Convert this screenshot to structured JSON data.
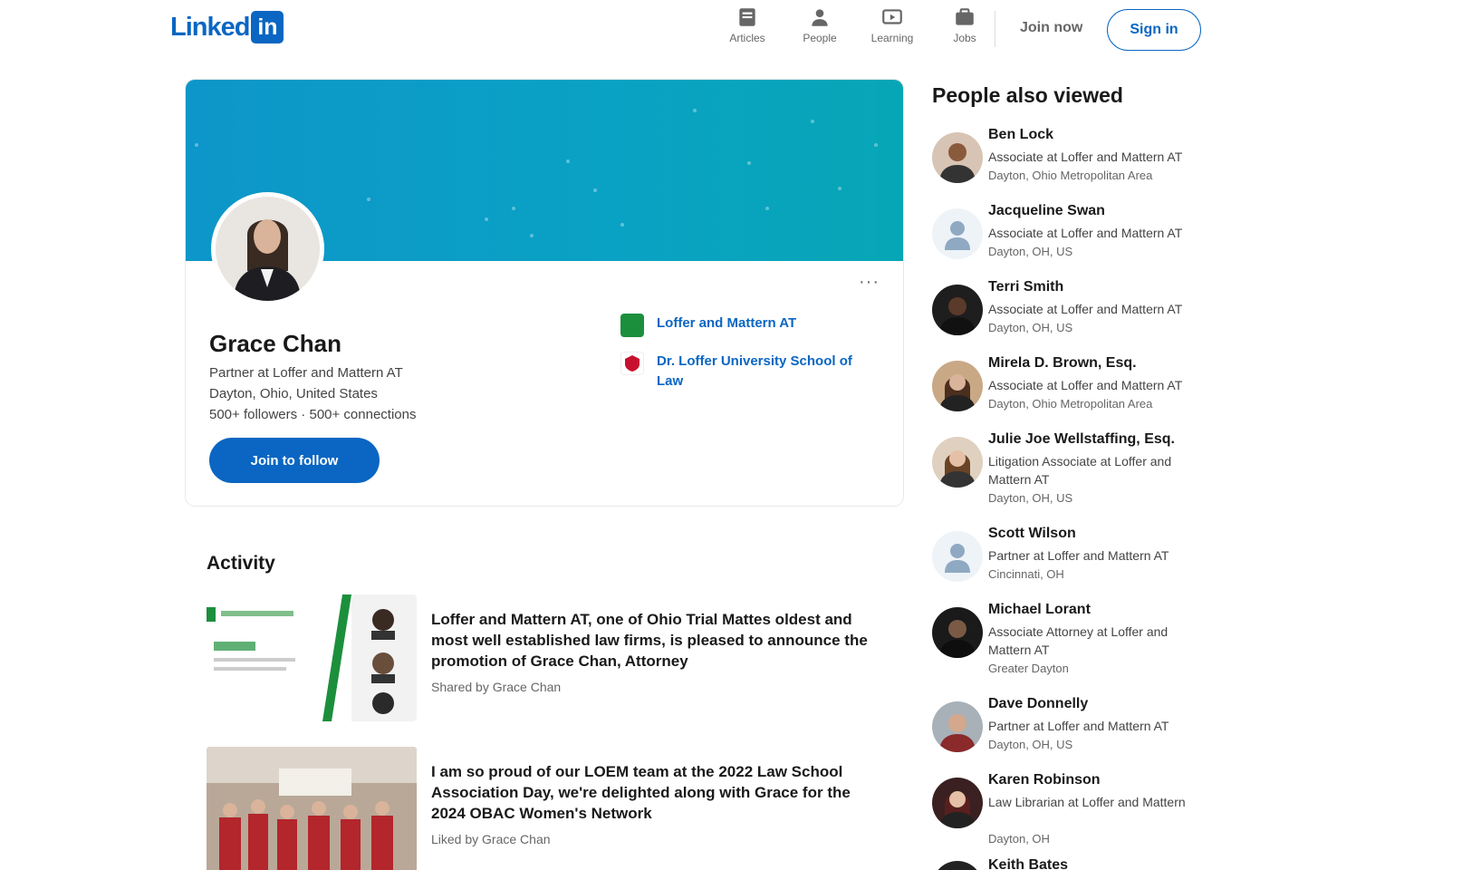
{
  "brand": {
    "name": "Linked",
    "mark": "in"
  },
  "nav": {
    "items": [
      {
        "label": "Articles",
        "icon": "articles-icon"
      },
      {
        "label": "People",
        "icon": "people-icon"
      },
      {
        "label": "Learning",
        "icon": "learning-icon"
      },
      {
        "label": "Jobs",
        "icon": "jobs-icon"
      }
    ],
    "join_label": "Join now",
    "signin_label": "Sign in"
  },
  "profile": {
    "name": "Grace Chan",
    "headline_lines": [
      "Partner at Loffer and Mattern AT",
      "Dayton, Ohio, United States",
      "500+ followers · 500+ connections"
    ],
    "follow_label": "Join to follow",
    "more_label": "···",
    "experience": [
      {
        "text": "Loffer and Mattern AT",
        "color": "#1c8f3c"
      },
      {
        "text": "Dr. Loffer University School of Law",
        "color": "#c8102e"
      }
    ]
  },
  "activity": {
    "title": "Activity",
    "posts": [
      {
        "title": "Loffer and Mattern AT, one of Ohio Trial Mattes oldest and most well established law firms, is pleased to announce the promotion of Grace Chan, Attorney",
        "meta": "Shared by Grace Chan"
      },
      {
        "title": "I am so proud of our LOEM team at the 2022 Law School Association Day, we're delighted along with Grace for the 2024 OBAC Women's Network",
        "meta": "Liked by Grace Chan"
      }
    ]
  },
  "rail": {
    "title": "People also viewed",
    "people": [
      {
        "name": "Ben Lock",
        "role": "Associate at Loffer and Mattern AT",
        "loc": "Dayton, Ohio Metropolitan Area"
      },
      {
        "name": "Jacqueline Swan",
        "role": "Associate at Loffer and Mattern AT",
        "loc": "Dayton, OH, US"
      },
      {
        "name": "Terri Smith",
        "role": "Associate at Loffer and Mattern AT",
        "loc": "Dayton, OH, US"
      },
      {
        "name": "Mirela D. Brown, Esq.",
        "role": "Associate at Loffer and Mattern AT",
        "loc": "Dayton, Ohio Metropolitan Area"
      },
      {
        "name": "Julie Joe Wellstaffing, Esq.",
        "role": "Litigation Associate at Loffer and Mattern AT",
        "loc": "Dayton, OH, US"
      },
      {
        "name": "Scott Wilson",
        "role": "Partner at Loffer and Mattern AT",
        "loc": "Cincinnati, OH"
      },
      {
        "name": "Michael Lorant",
        "role": "Associate Attorney at Loffer and Mattern AT",
        "loc": "Greater Dayton"
      },
      {
        "name": "Dave Donnelly",
        "role": "Partner at Loffer and Mattern AT",
        "loc": "Dayton, OH, US"
      },
      {
        "name": "Karen Robinson",
        "role": "Law Librarian at Loffer and Mattern",
        "loc": "Dayton, OH"
      },
      {
        "name": "Keith Bates",
        "role": "",
        "loc": ""
      }
    ]
  },
  "colors": {
    "accent": "#0a66c2",
    "banner": "#0aa2c4"
  }
}
